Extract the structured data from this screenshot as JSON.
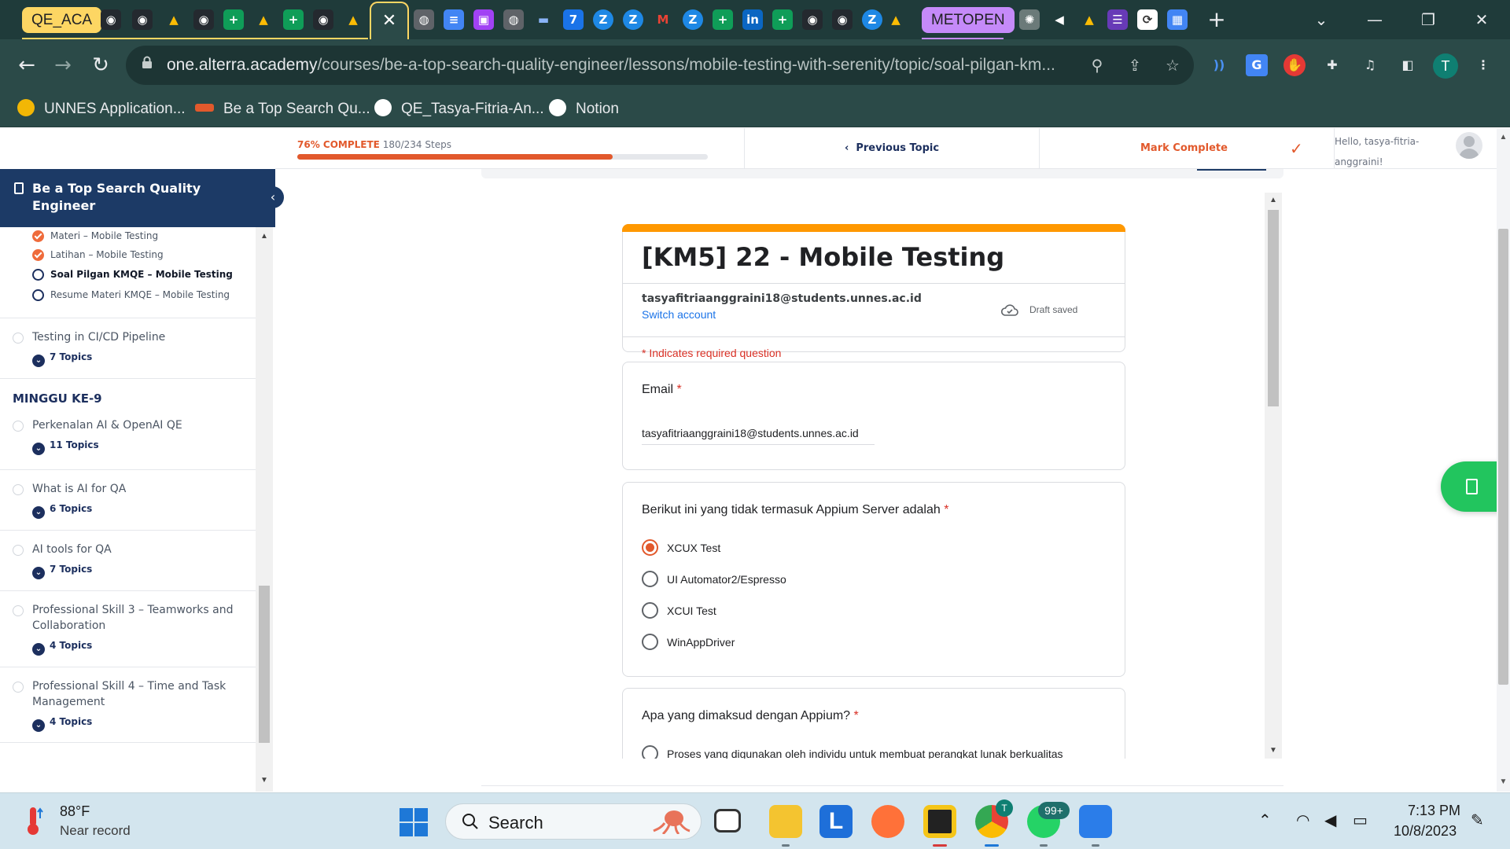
{
  "browser": {
    "tab_groups": [
      {
        "label": "QE_ACA",
        "color": "#fdd663"
      },
      {
        "label": "METOPEN",
        "color": "#c58af9"
      }
    ],
    "active_tab_close_glyph": "✕",
    "new_tab_glyph": "+",
    "window_controls": {
      "dropdown": "⌄",
      "minimize": "—",
      "maximize": "❐",
      "close": "✕"
    },
    "url_host": "one.alterra.academy",
    "url_path": "/courses/be-a-top-search-quality-engineer/lessons/mobile-testing-with-serenity/topic/soal-pilgan-km...",
    "profile_initial": "T",
    "bookmarks": [
      {
        "label": "UNNES Application...",
        "icon": "unnes-logo-icon",
        "color": "#f2b705"
      },
      {
        "label": "Be a Top Search Qu...",
        "icon": "alterra-logo-icon",
        "color": "#e2592c"
      },
      {
        "label": "QE_Tasya-Fitria-An...",
        "icon": "github-icon",
        "color": "#ffffff"
      },
      {
        "label": "Notion",
        "icon": "globe-icon",
        "color": "#ffffff"
      }
    ]
  },
  "lms": {
    "progress_percent_label": "76% COMPLETE",
    "progress_steps": "180/234 Steps",
    "progress_fraction": 0.769,
    "previous_topic": "Previous Topic",
    "mark_complete": "Mark Complete",
    "greeting": "Hello, tasya-fitria-anggraini!",
    "course_title": "Be a Top Search Quality Engineer",
    "sub_items": [
      {
        "label": "Materi – Mobile Testing",
        "status": "done"
      },
      {
        "label": "Latihan – Mobile Testing",
        "status": "done"
      },
      {
        "label": "Soal Pilgan KMQE – Mobile Testing",
        "status": "current"
      },
      {
        "label": "Resume Materi KMQE – Mobile Testing",
        "status": "todo"
      }
    ],
    "lessons_before": [
      {
        "title": "Testing in CI/CD Pipeline",
        "topics": "7 Topics"
      }
    ],
    "week_heading": "MINGGU KE-9",
    "lessons_after": [
      {
        "title": "Perkenalan AI & OpenAI QE",
        "topics": "11 Topics"
      },
      {
        "title": "What is AI for QA",
        "topics": "6 Topics"
      },
      {
        "title": "AI tools for QA",
        "topics": "7 Topics"
      },
      {
        "title": "Professional Skill 3 – Teamworks and Collaboration",
        "topics": "4 Topics"
      },
      {
        "title": "Professional Skill 4 – Time and Task Management",
        "topics": "4 Topics"
      }
    ]
  },
  "form": {
    "title": "[KM5] 22 - Mobile Testing",
    "account_email": "tasyafitriaanggraini18@students.unnes.ac.id",
    "switch_account": "Switch account",
    "draft_status": "Draft saved",
    "required_note": "* Indicates required question",
    "email_question": "Email",
    "email_value": "tasyafitriaanggraini18@students.unnes.ac.id",
    "required_mark": "*",
    "q1": {
      "title": "Berikut ini yang tidak termasuk Appium Server adalah",
      "options": [
        "XCUX Test",
        "UI Automator2/Espresso",
        "XCUI Test",
        "WinAppDriver"
      ],
      "selected_index": 0
    },
    "q2": {
      "title": "Apa yang dimaksud dengan Appium?",
      "first_option_partial": "Proses yang digunakan oleh individu untuk membuat perangkat lunak berkualitas"
    },
    "accent_color": "#ff9800",
    "selection_color": "#e2592c"
  },
  "taskbar": {
    "weather_temp": "88°F",
    "weather_desc": "Near record",
    "search_placeholder": "Search",
    "whatsapp_badge": "99+",
    "chrome_badge": "T",
    "time": "7:13 PM",
    "date": "10/8/2023"
  }
}
